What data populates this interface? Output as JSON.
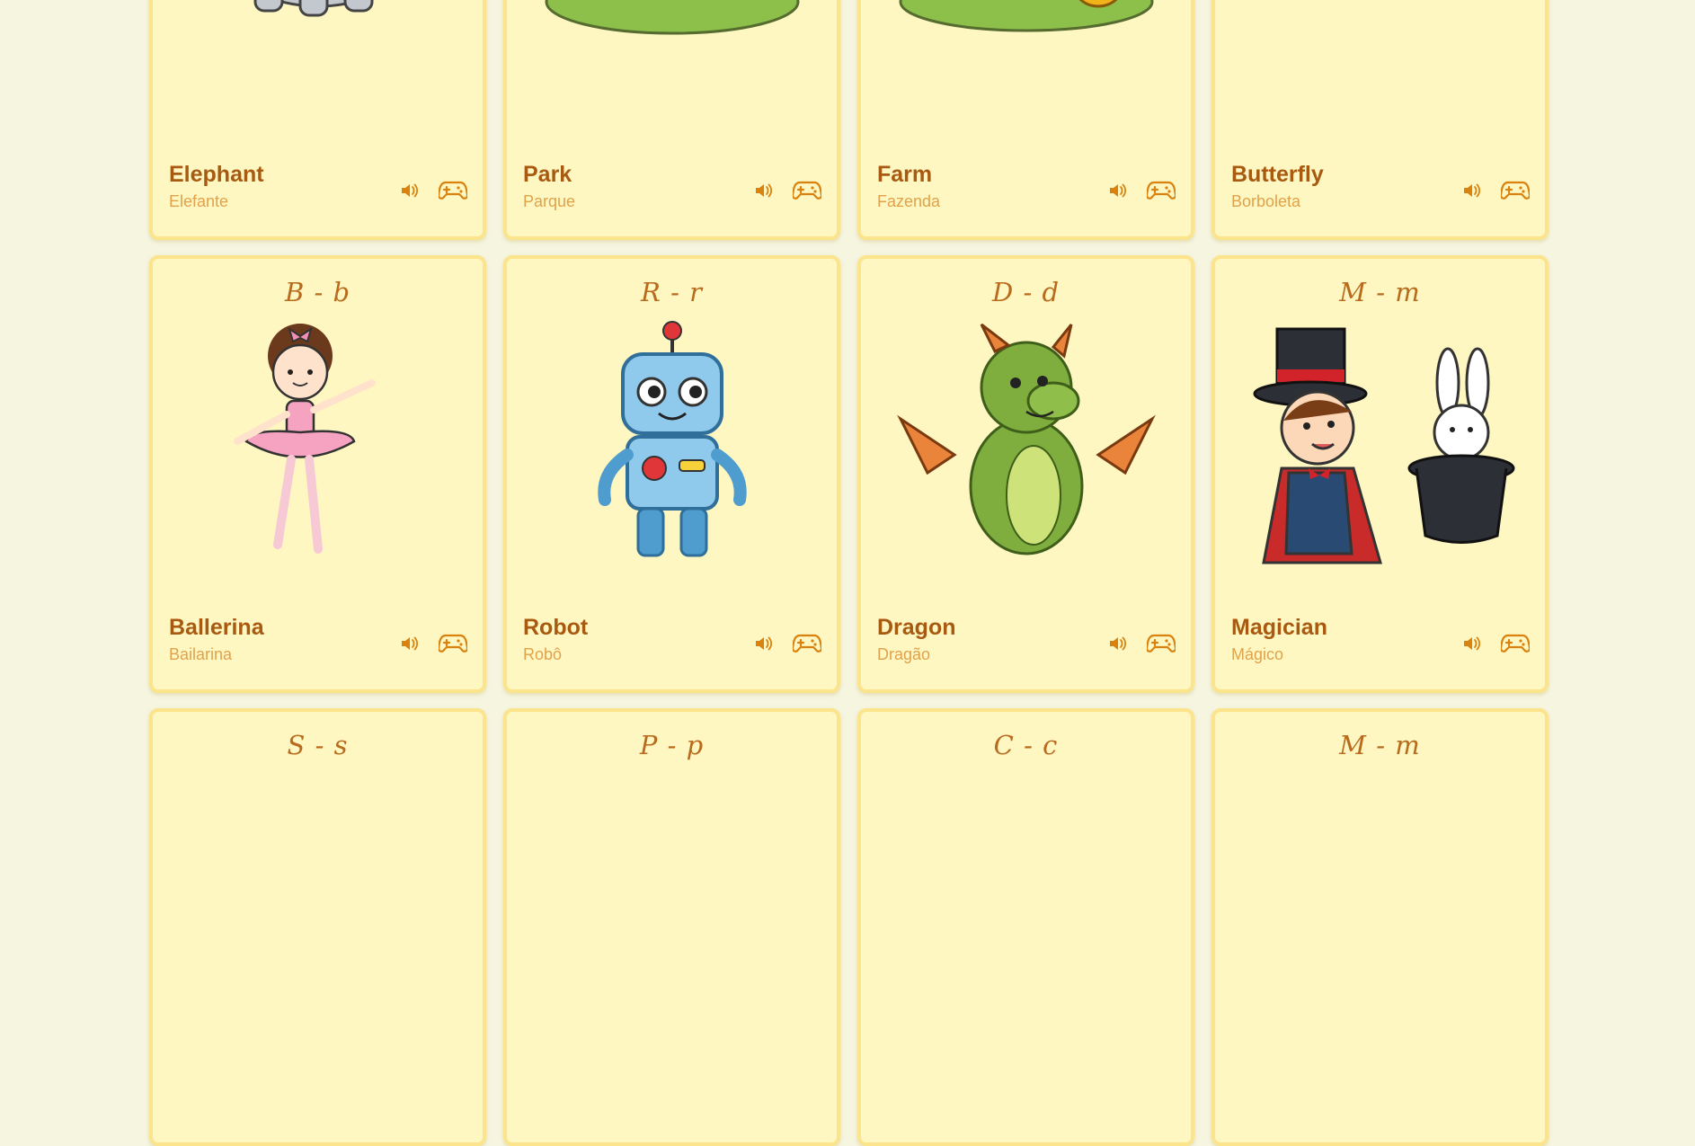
{
  "cards": [
    {
      "letter": "",
      "title": "Elephant",
      "translation": "Elefante",
      "image": "elephant"
    },
    {
      "letter": "",
      "title": "Park",
      "translation": "Parque",
      "image": "park"
    },
    {
      "letter": "",
      "title": "Farm",
      "translation": "Fazenda",
      "image": "farm"
    },
    {
      "letter": "",
      "title": "Butterfly",
      "translation": "Borboleta",
      "image": "butterfly"
    },
    {
      "letter": "B - b",
      "title": "Ballerina",
      "translation": "Bailarina",
      "image": "ballerina"
    },
    {
      "letter": "R - r",
      "title": "Robot",
      "translation": "Robô",
      "image": "robot"
    },
    {
      "letter": "D - d",
      "title": "Dragon",
      "translation": "Dragão",
      "image": "dragon"
    },
    {
      "letter": "M - m",
      "title": "Magician",
      "translation": "Mágico",
      "image": "magician"
    },
    {
      "letter": "S - s",
      "title": "",
      "translation": "",
      "image": ""
    },
    {
      "letter": "P - p",
      "title": "",
      "translation": "",
      "image": ""
    },
    {
      "letter": "C - c",
      "title": "",
      "translation": "",
      "image": ""
    },
    {
      "letter": "M - m",
      "title": "",
      "translation": "",
      "image": ""
    }
  ],
  "icons": {
    "audio": "speaker-icon",
    "game": "gamepad-icon"
  },
  "colors": {
    "background": "#f6f5df",
    "card": "#fff7c2",
    "card_border": "#fbe48c",
    "title": "#a85a11",
    "translation": "#e0a24a",
    "icon": "#d9820f"
  }
}
